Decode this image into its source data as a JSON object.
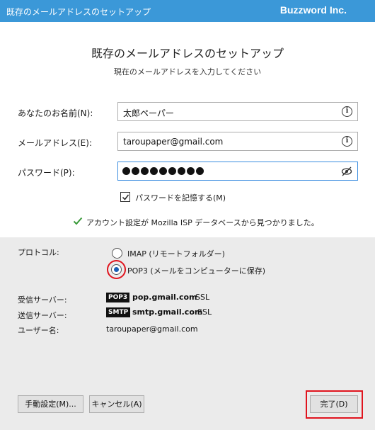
{
  "window": {
    "title": "既存のメールアドレスのセットアップ",
    "brand": "Buzzword Inc."
  },
  "header": {
    "heading": "既存のメールアドレスのセットアップ",
    "subheading": "現在のメールアドレスを入力してください"
  },
  "form": {
    "name_label": "あなたのお名前(N):",
    "name_value": "太郎ペーパー",
    "email_label": "メールアドレス(E):",
    "email_value": "taroupaper@gmail.com",
    "password_label": "パスワード(P):",
    "password_masked": true,
    "remember_label": "パスワードを記憶する(M)",
    "remember_checked": true
  },
  "status": {
    "message": "アカウント設定が Mozilla ISP データベースから見つかりました。",
    "icon": "check-icon",
    "color": "#3a9a3a"
  },
  "protocol": {
    "label": "プロトコル:",
    "options": [
      {
        "label": "IMAP (リモートフォルダー)",
        "selected": false
      },
      {
        "label": "POP3 (メールをコンピューターに保存)",
        "selected": true
      }
    ]
  },
  "servers": {
    "incoming_label": "受信サーバー:",
    "incoming_badge": "POP3",
    "incoming_host": "pop.gmail.com",
    "incoming_ssl": "SSL",
    "outgoing_label": "送信サーバー:",
    "outgoing_badge": "SMTP",
    "outgoing_host": "smtp.gmail.com",
    "outgoing_ssl": "SSL",
    "username_label": "ユーザー名:",
    "username_value": "taroupaper@gmail.com"
  },
  "buttons": {
    "manual": "手動設定(M)...",
    "cancel": "キャンセル(A)",
    "done": "完了(D)"
  },
  "colors": {
    "titlebar": "#3b98d8",
    "highlight": "#e0141e",
    "radio_selected": "#1a5fb4"
  }
}
